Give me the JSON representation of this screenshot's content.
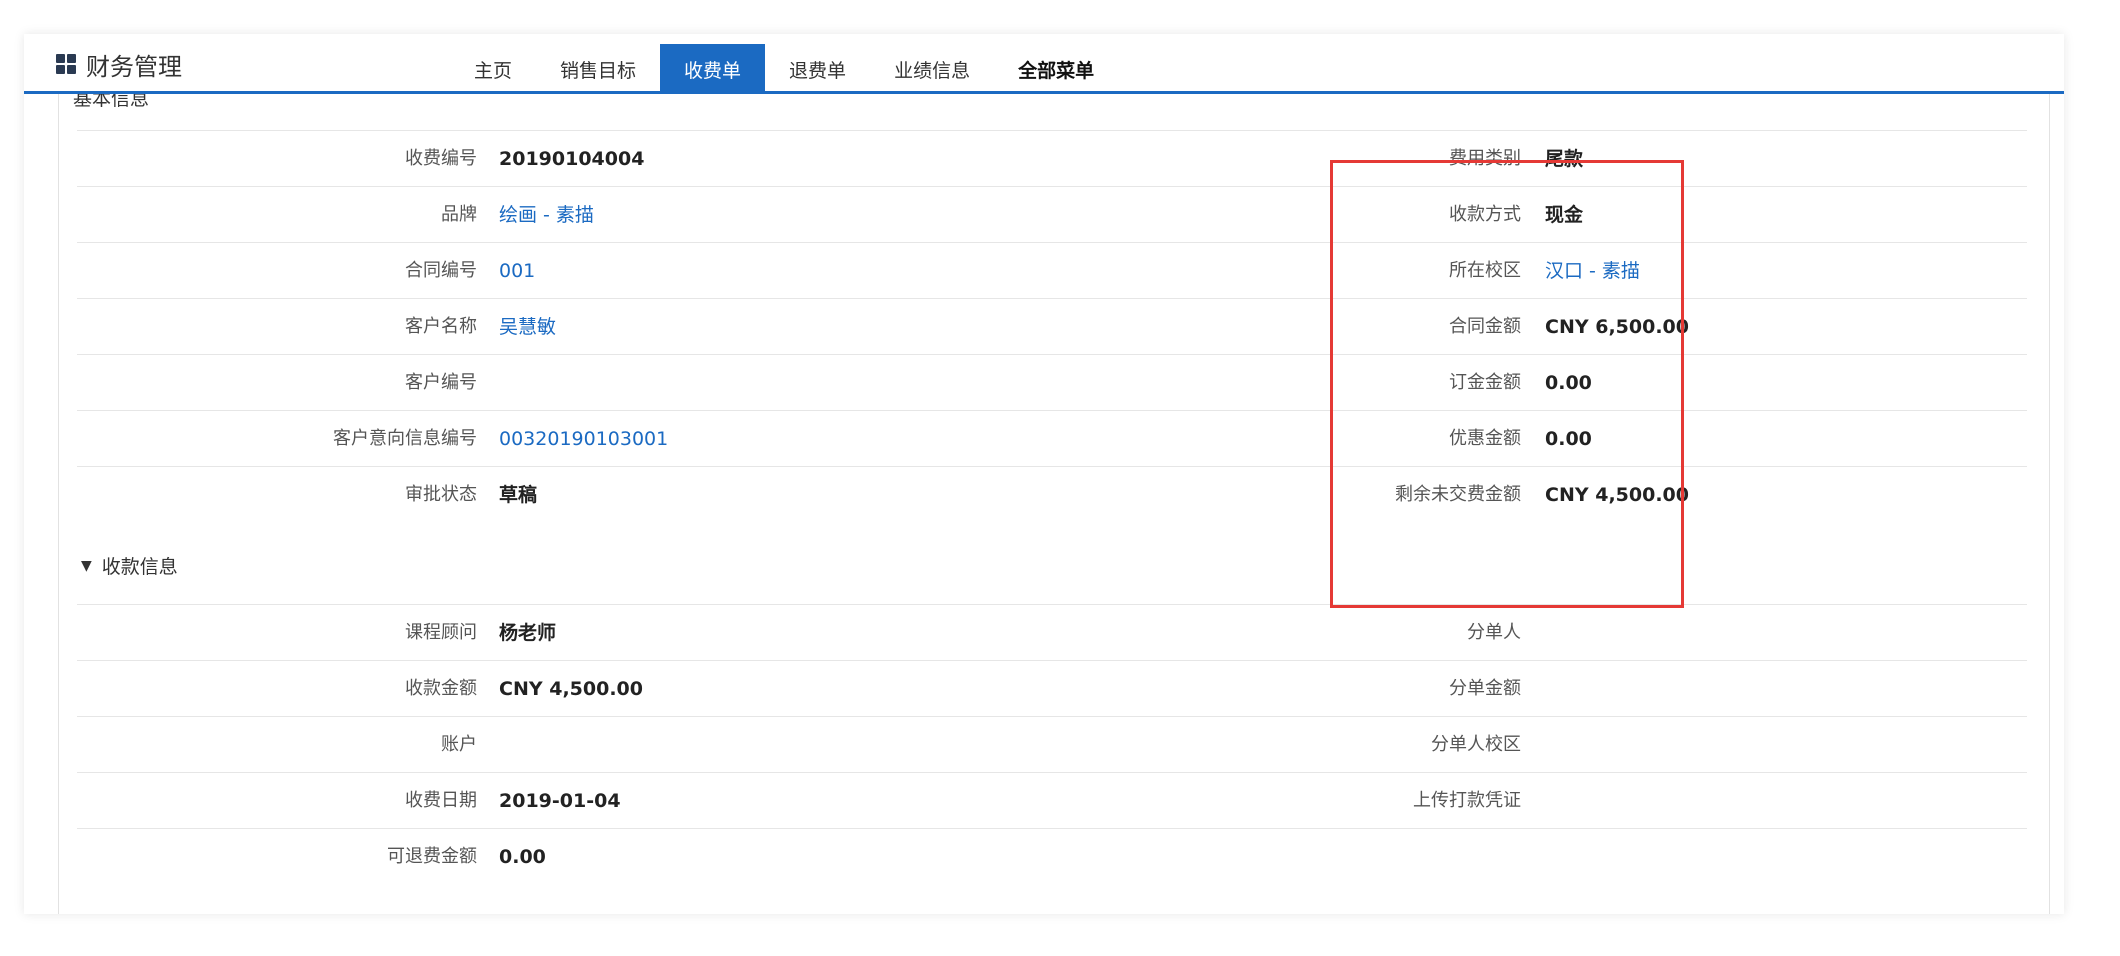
{
  "app": {
    "title": "财务管理",
    "icon": "grid-icon"
  },
  "tabs": [
    {
      "label": "主页",
      "active": false
    },
    {
      "label": "销售目标",
      "active": false
    },
    {
      "label": "收费单",
      "active": true
    },
    {
      "label": "退费单",
      "active": false
    },
    {
      "label": "业绩信息",
      "active": false
    },
    {
      "label": "全部菜单",
      "active": false
    }
  ],
  "basic_section": {
    "title": "基本信息"
  },
  "basic_rows": [
    {
      "left_label": "收费编号",
      "left_value": "20190104004",
      "right_label": "费用类别",
      "right_value": "尾款"
    },
    {
      "left_label": "品牌",
      "left_value": "绘画 - 素描",
      "right_label": "收款方式",
      "right_value": "现金"
    },
    {
      "left_label": "合同编号",
      "left_value": "001",
      "right_label": "所在校区",
      "right_value": "汉口 - 素描"
    },
    {
      "left_label": "客户名称",
      "left_value": "吴慧敏",
      "right_label": "合同金额",
      "right_value": "CNY 6,500.00"
    },
    {
      "left_label": "客户编号",
      "left_value": "",
      "right_label": "订金金额",
      "right_value": "0.00"
    },
    {
      "left_label": "客户意向信息编号",
      "left_value": "00320190103001",
      "right_label": "优惠金额",
      "right_value": "0.00"
    },
    {
      "left_label": "审批状态",
      "left_value": "草稿",
      "right_label": "剩余未交费金额",
      "right_value": "CNY 4,500.00"
    }
  ],
  "payment_section": {
    "title": "收款信息",
    "toggle": "▼"
  },
  "payment_rows": [
    {
      "left_label": "课程顾问",
      "left_value": "杨老师",
      "right_label": "分单人",
      "right_value": ""
    },
    {
      "left_label": "收款金额",
      "left_value": "CNY 4,500.00",
      "right_label": "分单金额",
      "right_value": ""
    },
    {
      "left_label": "账户",
      "left_value": "",
      "right_label": "分单人校区",
      "right_value": ""
    },
    {
      "left_label": "收费日期",
      "left_value": "2019-01-04",
      "right_label": "上传打款凭证",
      "right_value": ""
    },
    {
      "left_label": "可退费金额",
      "left_value": "0.00",
      "right_label": "",
      "right_value": ""
    }
  ],
  "colors": {
    "accent": "#1b6ac2",
    "highlight": "#e53935"
  }
}
